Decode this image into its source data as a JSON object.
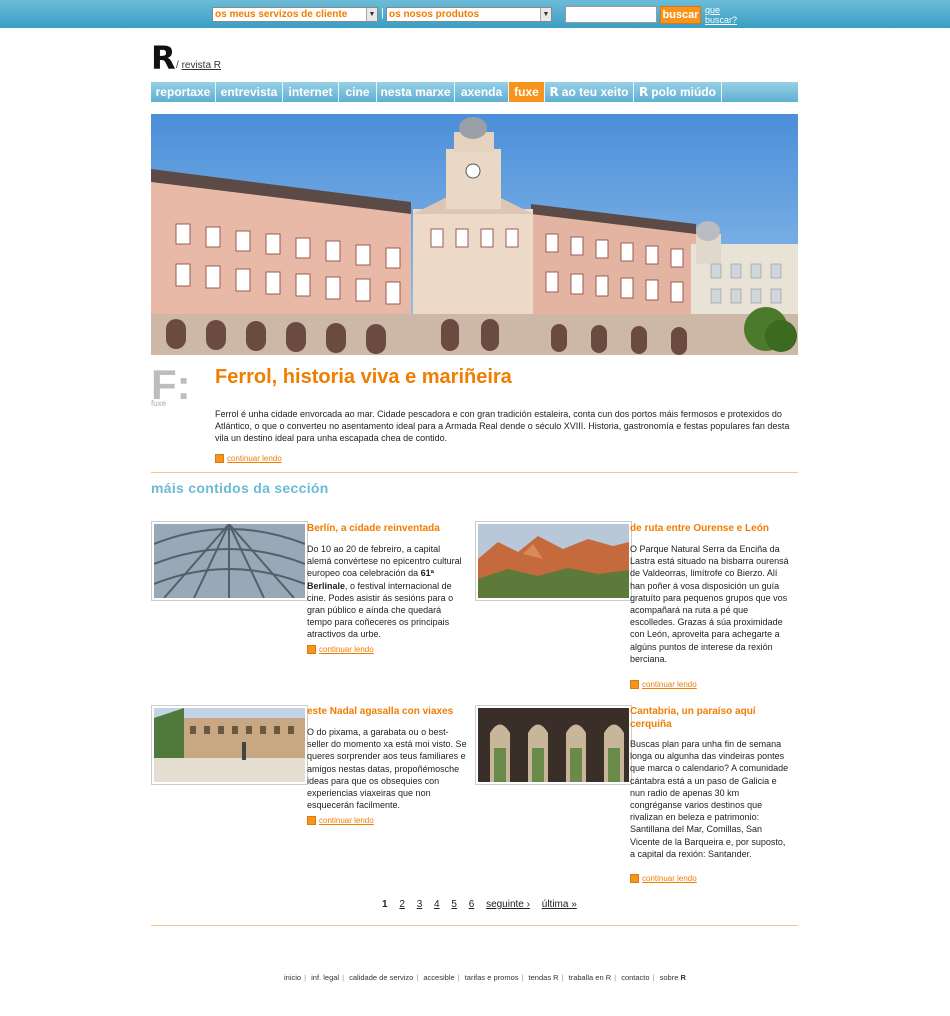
{
  "topbar": {
    "select_services": "os meus servizos de cliente",
    "separator": "|",
    "select_products": "os nosos produtos",
    "search_button": "buscar",
    "what_search_1": "que",
    "what_search_2": "buscar?"
  },
  "logo": {
    "mark": "R",
    "slash": "/",
    "link": "revista R"
  },
  "nav": {
    "items": [
      {
        "label": "reportaxe"
      },
      {
        "label": "entrevista"
      },
      {
        "label": "internet"
      },
      {
        "label": "cine"
      },
      {
        "label": "nesta marxe"
      },
      {
        "label": "axenda"
      },
      {
        "label": "fuxe",
        "active": true
      },
      {
        "label": "ao teu xeito",
        "mark": "R"
      },
      {
        "label": "polo miúdo",
        "mark": "R"
      }
    ]
  },
  "feature": {
    "section_letter": "F:",
    "section_label": "fuxe",
    "title": "Ferrol, historia viva e mariñeira",
    "description": "Ferrol é unha cidade envorcada ao mar. Cidade pescadora e con gran tradición estaleira, conta cun dos portos máis fermosos e protexidos do Atlántico, o que o converteu no asentamento ideal para a Armada Real dende o século XVIII. Historia, gastronomía e festas populares fan desta vila un destino ideal para unha escapada chea de contido.",
    "continue": "continuar lendo"
  },
  "section_heading": "máis contidos da sección",
  "cards": [
    {
      "title": "Berlín, a cidade reinventada",
      "text_before": "Do 10 ao 20 de febreiro, a capital alemá convértese no epicentro cultural europeo coa celebración da ",
      "text_bold": "61ª Berlinale",
      "text_after": ", o festival internacional de cine. Podes asistir ás sesións para o gran público e aínda che quedará tempo para coñeceres os principais atractivos da urbe.",
      "continue": "continuar lendo"
    },
    {
      "title": "de ruta entre Ourense e León",
      "text": "O Parque Natural Serra da Enciña da Lastra está situado na bisbarra ourensá de Valdeorras, limítrofe co Bierzo. Alí han poñer á vosa disposición un guía gratuíto para pequenos grupos que vos acompañará na ruta a pé que escolledes. Grazas á súa proximidade con León, aproveita para achegarte a algúns puntos de interese da rexión berciana.",
      "continue": "continuar lendo"
    },
    {
      "title": "este Nadal agasalla con viaxes",
      "text": "O do pixama, a garabata ou o best-seller do momento xa está moi visto. Se queres sorprender aos teus familiares e amigos nestas datas, propoñémosche ideas para que os obsequies con experiencias viaxeiras que non esquecerán facilmente.",
      "continue": "continuar lendo"
    },
    {
      "title": "Cantabria, un paraíso aquí cerquiña",
      "text": "Buscas plan para unha fin de semana longa ou algunha das vindeiras pontes que marca o calendario? A comunidade cántabra está a un paso de Galicia e nun radio de apenas 30 km congréganse varios destinos que rivalizan en beleza e patrimonio: Santillana del Mar, Comillas, San Vicente de la Barqueira e, por suposto, a capital da rexión: Santander.",
      "continue": "continuar lendo"
    }
  ],
  "pagination": {
    "current": "1",
    "pages": [
      "2",
      "3",
      "4",
      "5",
      "6"
    ],
    "next": "seguinte ›",
    "last": "última »"
  },
  "footer": {
    "links": [
      "inicio",
      "inf. legal",
      "calidade de servizo",
      "accesible",
      "tarifas e promos",
      "tendas R",
      "traballa en R",
      "contacto"
    ],
    "last_prefix": "sobre",
    "last_mark": "R"
  },
  "colors": {
    "accent": "#f07d00",
    "nav": "#5fb0d2",
    "section_heading": "#6bbbd6"
  }
}
